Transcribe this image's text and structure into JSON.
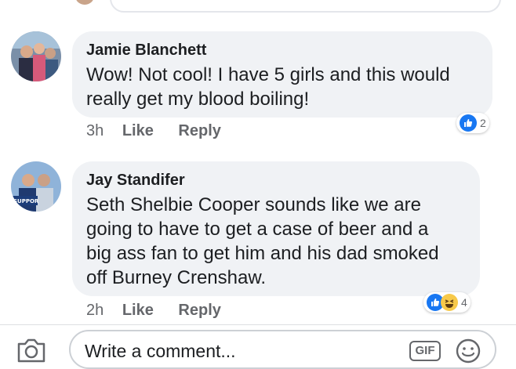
{
  "comments": [
    {
      "author": "Jamie Blanchett",
      "text_lines": [
        "Wow! Not cool! I have 5 girls and this would",
        "really get my blood boiling!"
      ],
      "time": "3h",
      "like_label": "Like",
      "reply_label": "Reply",
      "reaction_count": "2",
      "reactions": [
        "like-icon"
      ]
    },
    {
      "author": "Jay Standifer",
      "text_lines": [
        "Seth Shelbie Cooper sounds like we are",
        "going to have to get a case of beer and a",
        "big ass fan to get him and his dad smoked",
        "off Burney Crenshaw."
      ],
      "time": "2h",
      "like_label": "Like",
      "reply_label": "Reply",
      "reaction_count": "4",
      "reactions": [
        "like-icon",
        "haha-icon"
      ],
      "avatar_badge": "SUPPOR"
    }
  ],
  "composer": {
    "placeholder": "Write a comment...",
    "gif_label": "GIF"
  },
  "colors": {
    "bubble": "#f0f2f5",
    "like_blue": "#1877f2",
    "meta_gray": "#65676b"
  }
}
